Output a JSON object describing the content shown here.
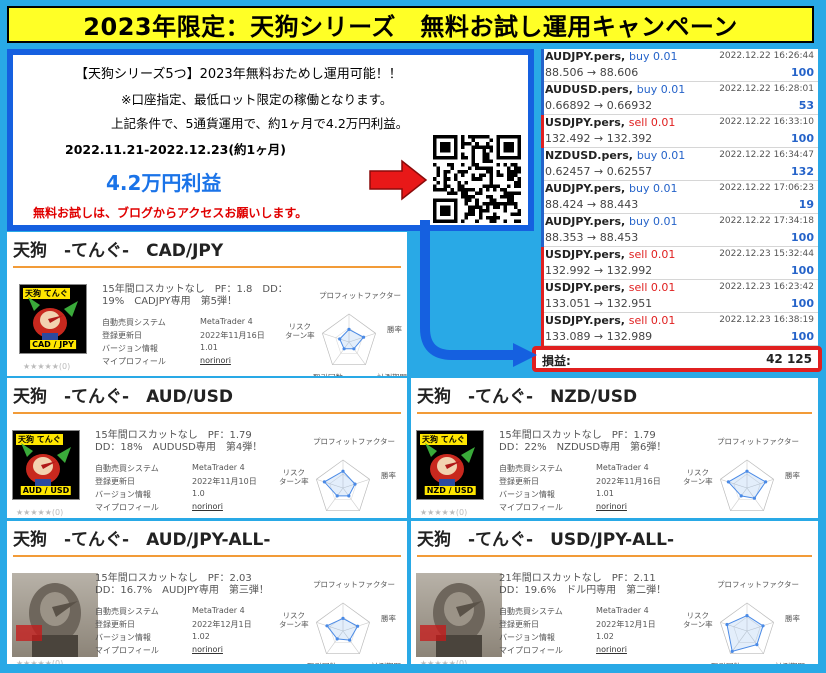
{
  "banner": {
    "title": "2023年限定：天狗シリーズ　無料お試し運用キャンペーン"
  },
  "promo": {
    "line1": "【天狗シリーズ5つ】2023年無料おためし運用可能！！",
    "line2": "※口座指定、最低ロット限定の稼働となります。",
    "line3": "上記条件で、5通貨運用で、約1ヶ月で4.2万円利益。",
    "period": "2022.11.21-2022.12.23(約1ヶ月)",
    "profit": "4.2万円利益",
    "note": "無料お試しは、ブログからアクセスお願いします。"
  },
  "trades": [
    {
      "symbol": "AUDJPY.pers,",
      "side": "buy 0.01",
      "time": "2022.12.22 16:26:44",
      "prices": "88.506 → 88.606",
      "profit": "100"
    },
    {
      "symbol": "AUDUSD.pers,",
      "side": "buy 0.01",
      "time": "2022.12.22 16:28:01",
      "prices": "0.66892 → 0.66932",
      "profit": "53"
    },
    {
      "symbol": "USDJPY.pers,",
      "side": "sell 0.01",
      "time": "2022.12.22 16:33:10",
      "prices": "132.492 → 132.392",
      "profit": "100"
    },
    {
      "symbol": "NZDUSD.pers,",
      "side": "buy 0.01",
      "time": "2022.12.22 16:34:47",
      "prices": "0.62457 → 0.62557",
      "profit": "132"
    },
    {
      "symbol": "AUDJPY.pers,",
      "side": "buy 0.01",
      "time": "2022.12.22 17:06:23",
      "prices": "88.424 → 88.443",
      "profit": "19"
    },
    {
      "symbol": "AUDJPY.pers,",
      "side": "buy 0.01",
      "time": "2022.12.22 17:34:18",
      "prices": "88.353 → 88.453",
      "profit": "100"
    },
    {
      "symbol": "USDJPY.pers,",
      "side": "sell 0.01",
      "time": "2022.12.23 15:32:44",
      "prices": "132.992 → 132.992",
      "profit": "100"
    },
    {
      "symbol": "USDJPY.pers,",
      "side": "sell 0.01",
      "time": "2022.12.23 16:23:42",
      "prices": "133.051 → 132.951",
      "profit": "100"
    },
    {
      "symbol": "USDJPY.pers,",
      "side": "sell 0.01",
      "time": "2022.12.23 16:38:19",
      "prices": "133.089 → 132.989",
      "profit": "100"
    }
  ],
  "balance": {
    "label": "損益:",
    "value": "42 125"
  },
  "common": {
    "system_label": "自動売買システム",
    "updated_label": "登録更新日",
    "version_label": "バージョン情報",
    "profile_label": "マイプロフィール",
    "platform": "MetaTrader 4",
    "profile": "norinori",
    "stars": "★★★★★(0)",
    "radar_profit": "プロフィットファクター",
    "radar_win": "勝率",
    "radar_risk": "リスク\nターン率",
    "radar_trades": "取引回数",
    "radar_period": "計測期間",
    "colors": {
      "background": "#29a9e6",
      "banner": "#ffff26",
      "promo_border": "#1560e0",
      "buy": "#2563c9",
      "sell": "#e02020",
      "rule": "#f29b38"
    }
  },
  "cards": [
    {
      "title": "天狗　-てんぐ-　CAD/JPY",
      "desc1": "15年間ロスカットなし　PF：1.8　DD：",
      "desc2": "19%　CADJPY専用　第5弾！",
      "updated": "2022年11月16日",
      "version": "1.01",
      "thumb_label": "天狗 てんぐ",
      "thumb_pair": "CAD / JPY"
    },
    {
      "title": "天狗　-てんぐ-　AUD/USD",
      "desc1": "15年間ロスカットなし　PF：1.79",
      "desc2": "DD：18%　AUDUSD専用　第4弾！",
      "updated": "2022年11月10日",
      "version": "1.0",
      "thumb_label": "天狗 てんぐ",
      "thumb_pair": "AUD / USD"
    },
    {
      "title": "天狗　-てんぐ-　NZD/USD",
      "desc1": "15年間ロスカットなし　PF：1.79",
      "desc2": "DD：22%　NZDUSD専用　第6弾！",
      "updated": "2022年11月16日",
      "version": "1.01",
      "thumb_label": "天狗 てんぐ",
      "thumb_pair": "NZD / USD"
    },
    {
      "title": "天狗　-てんぐ-　AUD/JPY-ALL-",
      "desc1": "15年間ロスカットなし　PF：2.03",
      "desc2": "DD：16.7%　AUDJPY専用　第三弾！",
      "updated": "2022年12月1日",
      "version": "1.02"
    },
    {
      "title": "天狗　-てんぐ-　USD/JPY-ALL-",
      "desc1": "21年間ロスカットなし　PF：2.11",
      "desc2": "DD：19.6%　ドル円専用　第二弾！",
      "updated": "2022年12月1日",
      "version": "1.02"
    }
  ]
}
